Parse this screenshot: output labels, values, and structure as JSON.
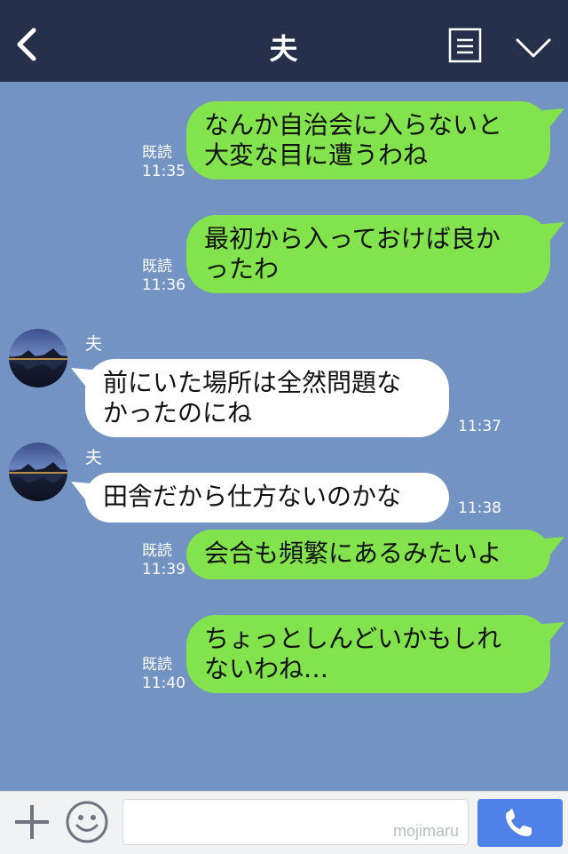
{
  "header": {
    "title": "夫",
    "back_icon": "chevron-left-icon",
    "menu_icon": "list-menu-icon",
    "collapse_icon": "chevron-down-icon"
  },
  "messages": [
    {
      "direction": "out",
      "lines": [
        "なんか自治会に入らないと",
        "大変な目に遭うわね"
      ],
      "status": "既読",
      "time": "11:35"
    },
    {
      "direction": "out",
      "lines": [
        "最初から入っておけば良か",
        "ったわ"
      ],
      "status": "既読",
      "time": "11:36"
    },
    {
      "direction": "in",
      "sender": "夫",
      "lines": [
        "前にいた場所は全然問題な",
        "かったのにね"
      ],
      "time": "11:37"
    },
    {
      "direction": "in",
      "sender": "夫",
      "lines": [
        "田舎だから仕方ないのかな"
      ],
      "time": "11:38"
    },
    {
      "direction": "out",
      "lines": [
        "会合も頻繁にあるみたいよ"
      ],
      "status": "既読",
      "time": "11:39"
    },
    {
      "direction": "out",
      "lines": [
        "ちょっとしんどいかもしれ",
        "ないわね…"
      ],
      "status": "既読",
      "time": "11:40"
    }
  ],
  "footer": {
    "input_placeholder": "",
    "watermark": "mojimaru",
    "plus_icon": "plus-icon",
    "emoji_icon": "smiley-icon",
    "call_icon": "phone-icon"
  },
  "colors": {
    "header_bg": "#26304a",
    "chat_bg": "#7393c3",
    "outgoing_bubble": "#83e34c",
    "incoming_bubble": "#ffffff",
    "call_button": "#4f82e8"
  }
}
